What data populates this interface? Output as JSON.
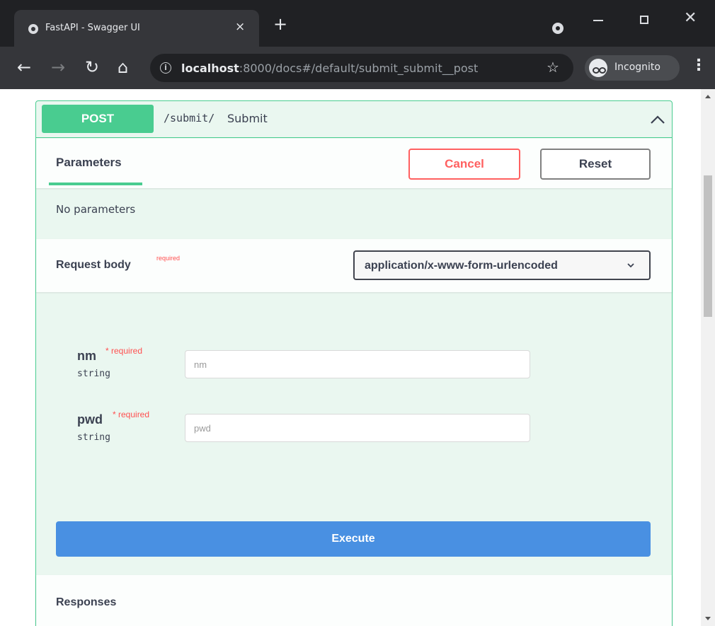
{
  "browser": {
    "tab_title": "FastAPI - Swagger UI",
    "tab_close": "×",
    "new_tab": "+",
    "url_host": "localhost",
    "url_rest": ":8000/docs#/default/submit_submit__post",
    "incognito_label": "Incognito"
  },
  "operation": {
    "method": "POST",
    "path": "/submit/",
    "summary": "Submit"
  },
  "parameters": {
    "tab_label": "Parameters",
    "cancel_label": "Cancel",
    "reset_label": "Reset",
    "empty_text": "No parameters"
  },
  "request_body": {
    "title": "Request body",
    "required_label": "required",
    "content_type": "application/x-www-form-urlencoded",
    "fields": [
      {
        "name": "nm",
        "star": "* required",
        "type": "string",
        "placeholder": "nm"
      },
      {
        "name": "pwd",
        "star": "* required",
        "type": "string",
        "placeholder": "pwd"
      }
    ]
  },
  "execute_label": "Execute",
  "responses_title": "Responses",
  "colors": {
    "post_green": "#49cc90",
    "opblock_bg": "#eaf7f0",
    "cancel_red": "#ff6060",
    "execute_blue": "#4990e2",
    "chrome_dark": "#202124"
  }
}
